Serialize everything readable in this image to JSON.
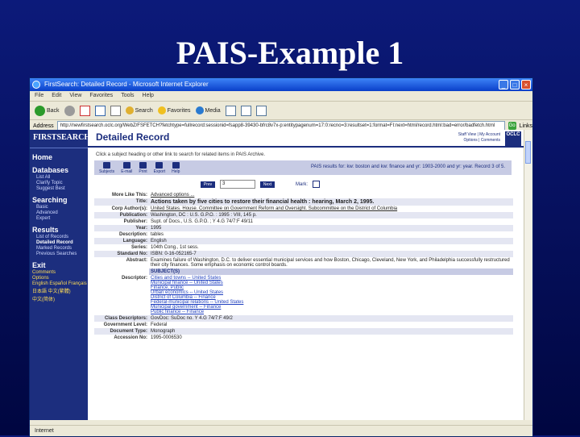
{
  "slide": {
    "title": "PAIS-Example 1"
  },
  "browser": {
    "title": "FirstSearch: Detailed Record - Microsoft Internet Explorer",
    "menu": [
      "File",
      "Edit",
      "View",
      "Favorites",
      "Tools",
      "Help"
    ],
    "toolbar": {
      "back": "Back",
      "search": "Search",
      "favorites": "Favorites",
      "media": "Media"
    },
    "address_label": "Address",
    "address": "http://newfirstsearch.oclc.org/WebZ/FSFETCH?fetchtype=fullrecord:sessionid=fsapp8-39430-bfrc8v7x-p:entitypagenum=17:0:recno=3:resultset=1:format=FI:next=html/record.html:bad=error/badfetch.html",
    "go": "Go",
    "links": "Links",
    "status": "Internet"
  },
  "sidebar": {
    "logo": "FIRSTSEARCH",
    "home": "Home",
    "databases": {
      "title": "Databases",
      "items": [
        "List All",
        "Clarify Topic",
        "Suggest Best"
      ]
    },
    "searching": {
      "title": "Searching",
      "items": [
        "Basic",
        "Advanced",
        "Expert"
      ]
    },
    "results": {
      "title": "Results",
      "items": [
        "List of Records",
        "Detailed Record",
        "Marked Records",
        "Previous Searches"
      ]
    },
    "exit": "Exit",
    "links": [
      "Comments",
      "Options",
      "English Español Français",
      "日本語  中文(繁體)",
      "中文(简体)"
    ]
  },
  "page": {
    "header_title": "Detailed Record",
    "header_links": [
      "Staff View | My Account",
      "Options | Comments"
    ],
    "oclc": "OCLC",
    "intro": "Click a subject heading or other link to search for related items in PAIS Archive.",
    "actions": [
      "Subjects",
      "E-mail",
      "Print",
      "Export",
      "Help"
    ],
    "query": "PAIS results for: kw: boston and kw: finance and yr: 1903-2000 and yr: year. Record 3 of 5.",
    "pager": {
      "prev": "Prev",
      "num": "3",
      "next": "Next",
      "mark": "Mark:"
    },
    "record": {
      "more_like_this_k": "More Like This:",
      "more_like_this_v": "Advanced options ...",
      "title_k": "Title:",
      "title_v": "Actions taken by five cities to restore their financial health : hearing, March 2, 1995.",
      "corp_k": "Corp Author(s):",
      "corp_v": "United States. House. Committee on Government Reform and Oversight. Subcommittee on the District of Columbia",
      "publication_k": "Publication:",
      "publication_v": "Washington, DC : U.S. G.P.O. : 1995 : VIII, 145 p.",
      "publisher_k": "Publisher:",
      "publisher_v": "Supt. of Docs., U.S. G.P.O. ; Y 4.G 74/7:F 49/11",
      "year_k": "Year:",
      "year_v": "1995",
      "description_k": "Description:",
      "description_v": "tables",
      "language_k": "Language:",
      "language_v": "English",
      "series_k": "Series:",
      "series_v": "104th Cong., 1st sess.",
      "standard_no_k": "Standard No:",
      "standard_no_v": "ISBN: 0-16-052165-7",
      "abstract_k": "Abstract:",
      "abstract_v": "Examines failure of Washington, D.C. to deliver essential municipal services and how Boston, Chicago, Cleveland, New York, and Philadelphia successfully restructured their city finances. Some emphasis on economic control boards.",
      "subjects_heading": "SUBJECT(S)",
      "descriptor_k": "Descriptor:",
      "descriptors": [
        "Cities and towns -- United States",
        "Municipal finance -- United States",
        "Finance, Public",
        "Urban economics -- United States",
        "District of Columbia -- Finance",
        "Federal-municipal relations -- United States",
        "Municipal government -- Finance",
        "Public finance -- Finance"
      ],
      "class_k": "Class Descriptors:",
      "class_v": "GovDoc: SuDoc no. Y 4.G 74/7:F 49/2",
      "gov_level_k": "Government Level:",
      "gov_level_v": "Federal",
      "doc_type_k": "Document Type:",
      "doc_type_v": "Monograph",
      "accession_k": "Accession No:",
      "accession_v": "1995-0006530"
    }
  }
}
